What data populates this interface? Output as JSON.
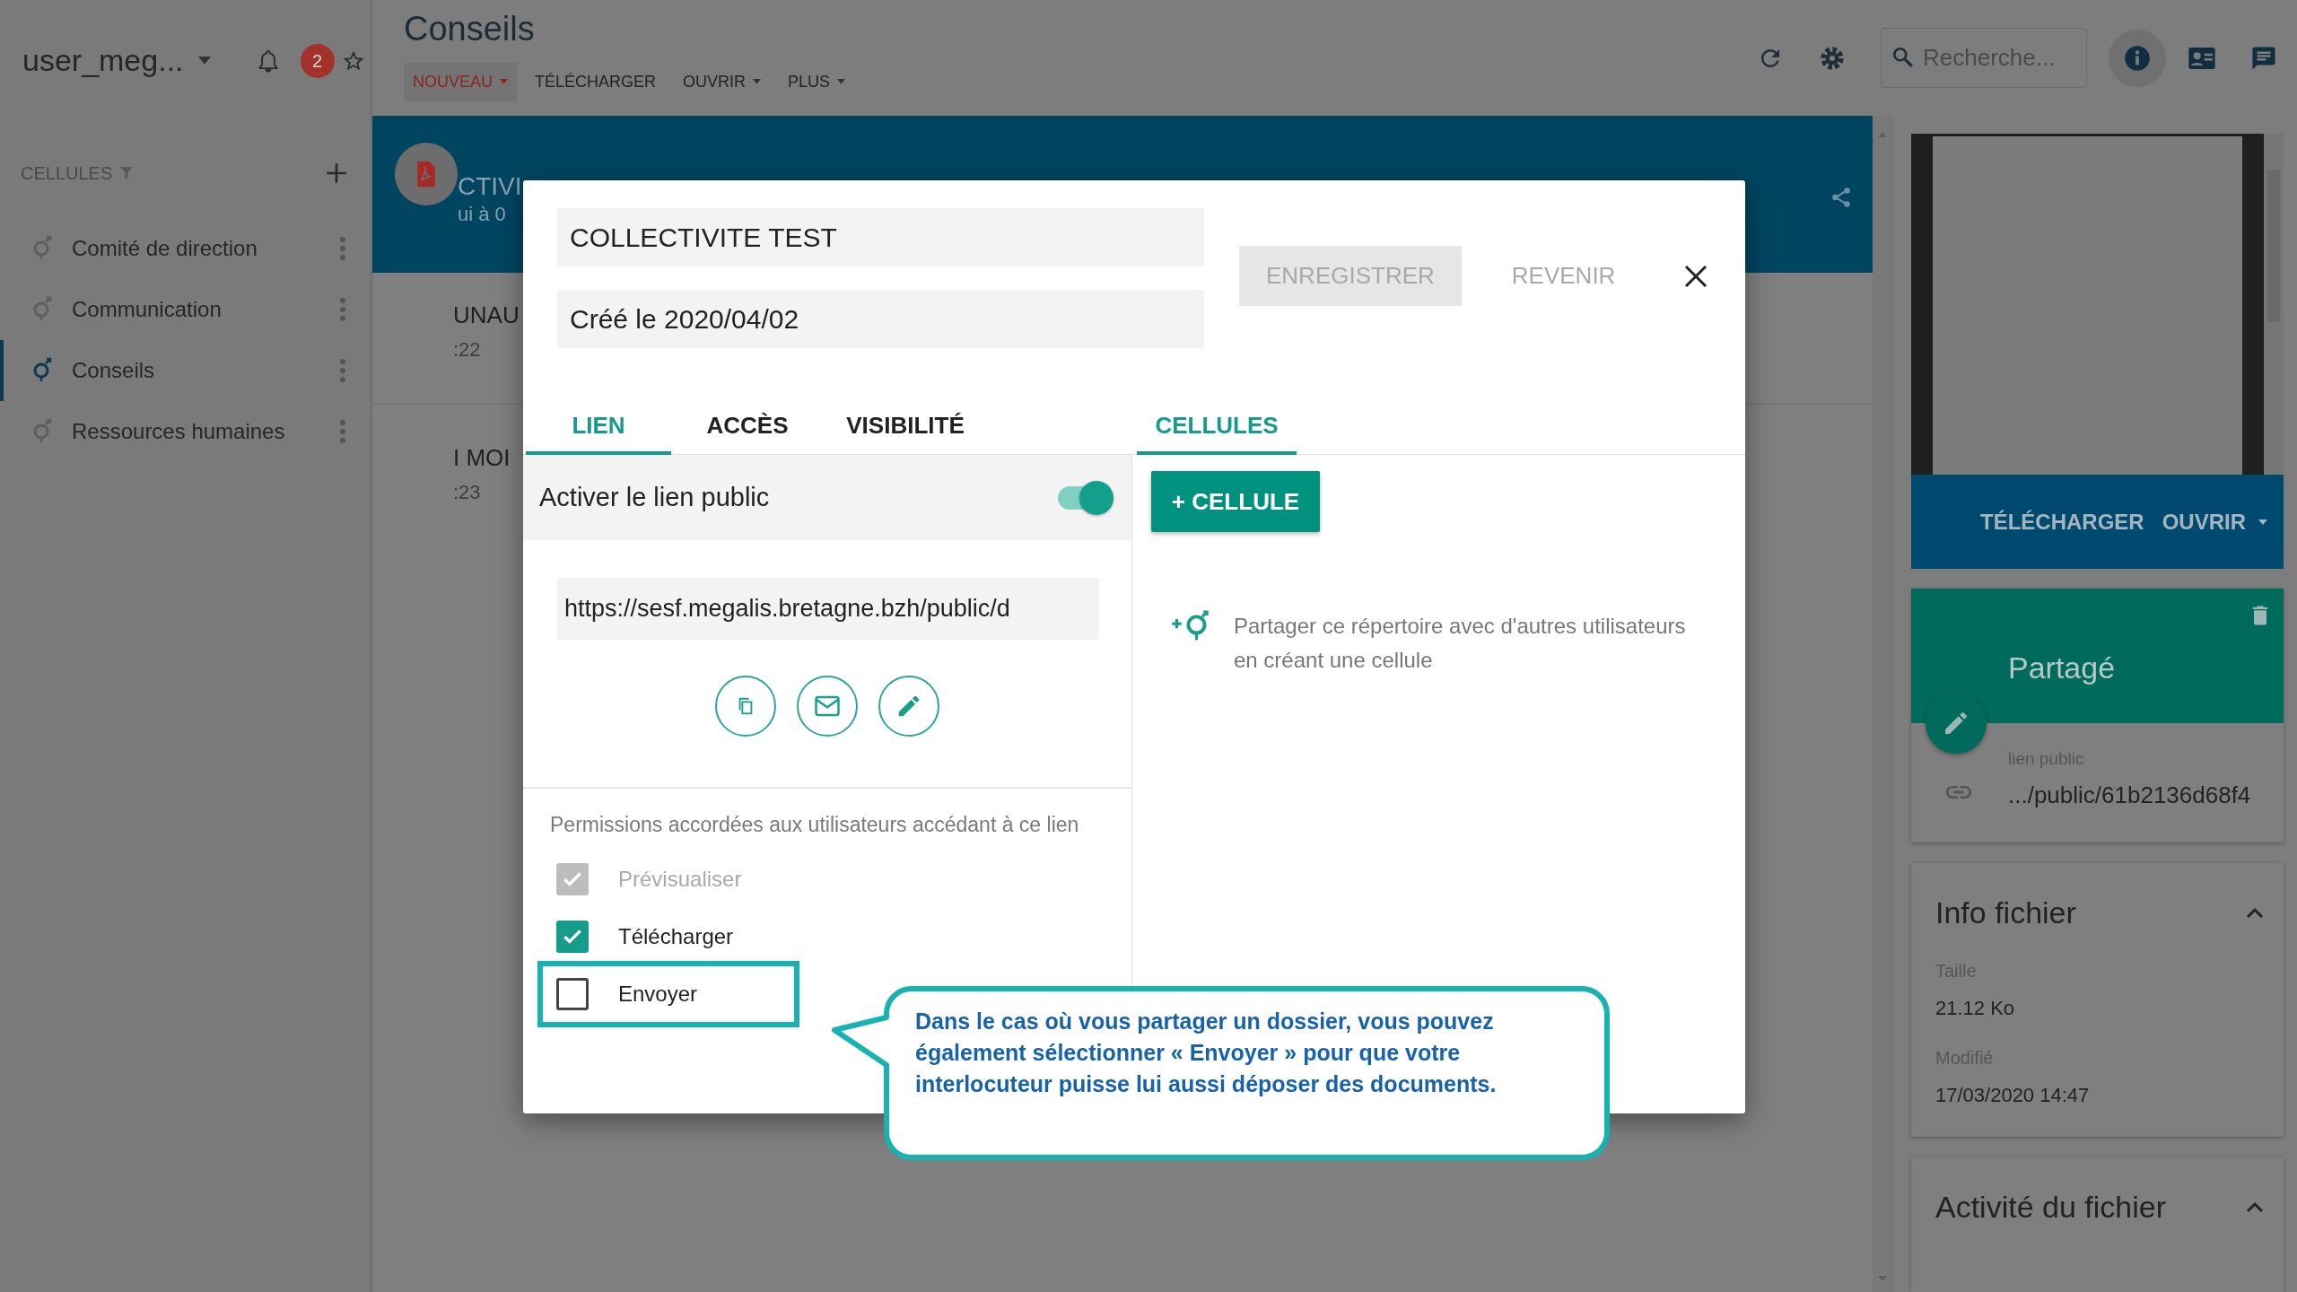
{
  "sidebar": {
    "user": "user_meg...",
    "notification_count": "2",
    "section_title": "CELLULES",
    "items": [
      {
        "label": "Comité de direction",
        "selected": false
      },
      {
        "label": "Communication",
        "selected": false
      },
      {
        "label": "Conseils",
        "selected": true
      },
      {
        "label": "Ressources humaines",
        "selected": false
      }
    ]
  },
  "header": {
    "title": "Conseils",
    "toolbar": [
      {
        "label": "NOUVEAU",
        "dropdown": true,
        "selected": true
      },
      {
        "label": "TÉLÉCHARGER",
        "dropdown": false,
        "selected": false
      },
      {
        "label": "OUVRIR",
        "dropdown": true,
        "selected": false
      },
      {
        "label": "PLUS",
        "dropdown": true,
        "selected": false
      }
    ],
    "search": {
      "placeholder": "Recherche..."
    }
  },
  "file_list": {
    "banner_lines": [
      "CTIVI",
      "ui à 0"
    ],
    "rows": [
      {
        "name": "UNAU",
        "time": ":22"
      },
      {
        "name": "I MOI",
        "time": ":23"
      }
    ]
  },
  "preview_panel": {
    "actions": [
      {
        "label": "TÉLÉCHARGER",
        "dropdown": false
      },
      {
        "label": "OUVRIR",
        "dropdown": true
      }
    ],
    "share_card": {
      "title": "Partagé",
      "link_label": "lien public",
      "link": ".../public/61b2136d68f4"
    },
    "info": {
      "title": "Info fichier",
      "expanded": true,
      "fields": [
        {
          "label": "Taille",
          "value": "21.12 Ko"
        },
        {
          "label": "Modifié",
          "value": "17/03/2020 14:47"
        }
      ]
    },
    "activity": {
      "title": "Activité du fichier",
      "expanded": true
    }
  },
  "dialog": {
    "name_field": "COLLECTIVITE TEST",
    "created": "Créé le 2020/04/02",
    "buttons": [
      {
        "label": "ENREGISTRER",
        "kind": "raised",
        "disabled": true
      },
      {
        "label": "REVENIR",
        "kind": "flat",
        "disabled": true
      }
    ],
    "tabs": [
      {
        "label": "LIEN",
        "selected": true
      },
      {
        "label": "ACCÈS",
        "selected": false
      },
      {
        "label": "VISIBILITÉ",
        "selected": false
      }
    ],
    "right_tabs": [
      {
        "label": "CELLULES",
        "selected": true
      }
    ],
    "public_link": {
      "label": "Activer le lien public",
      "on": true,
      "url": "https://sesf.megalis.bretagne.bzh/public/d"
    },
    "permissions_title": "Permissions accordées aux utilisateurs accédant à ce lien",
    "permissions": [
      {
        "label": "Prévisualiser",
        "checked": true,
        "disabled": true,
        "highlighted": false
      },
      {
        "label": "Télécharger",
        "checked": true,
        "disabled": false,
        "highlighted": false
      },
      {
        "label": "Envoyer",
        "checked": false,
        "disabled": false,
        "highlighted": true
      }
    ],
    "add_cell_button": "+ CELLULE",
    "cells_hint": "Partager ce répertoire avec d'autres utilisateurs en créant une cellule"
  },
  "callout": {
    "text": "Dans le cas où vous partager un dossier, vous pouvez également sélectionner « Envoyer » pour que votre interlocuteur puisse lui aussi déposer des documents."
  }
}
